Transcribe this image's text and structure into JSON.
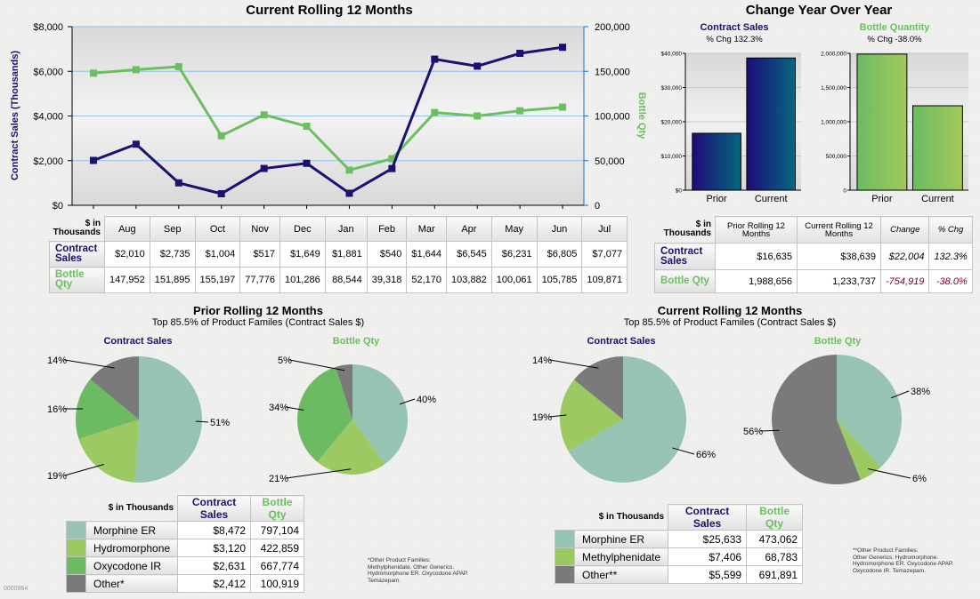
{
  "colors": {
    "navy": "#1c1070",
    "green": "#6bbf5f",
    "morphine_er": "#97c3b3",
    "hydromorphone": "#9dc962",
    "oxycodone_ir": "#6cbb63",
    "other": "#7a7a7a",
    "methylphenidate": "#9dc962",
    "negative": "#8b0020"
  },
  "chart_data": [
    {
      "id": "rolling12",
      "type": "line",
      "title": "Current Rolling 12 Months",
      "ylabel": "Contract Sales (Thousands)",
      "y2label": "Bottle Qty",
      "categories": [
        "Aug",
        "Sep",
        "Oct",
        "Nov",
        "Dec",
        "Jan",
        "Feb",
        "Mar",
        "Apr",
        "May",
        "Jun",
        "Jul"
      ],
      "ylim": [
        0,
        8000
      ],
      "y_ticks": [
        "$0",
        "$2,000",
        "$4,000",
        "$6,000",
        "$8,000"
      ],
      "y2lim": [
        0,
        200000
      ],
      "y2_ticks": [
        "0",
        "50,000",
        "100,000",
        "150,000",
        "200,000"
      ],
      "grid": true,
      "series": [
        {
          "name": "Contract Sales",
          "axis": "left",
          "values": [
            2010,
            2735,
            1004,
            517,
            1649,
            1881,
            540,
            1644,
            6545,
            6231,
            6805,
            7077
          ]
        },
        {
          "name": "Bottle Qty",
          "axis": "right",
          "values": [
            147952,
            151895,
            155197,
            77776,
            101286,
            88544,
            39318,
            52170,
            103882,
            100061,
            105785,
            109871
          ]
        }
      ]
    },
    {
      "id": "yoy_sales",
      "type": "bar",
      "title": "Contract Sales",
      "subtitle": "% Chg 132.3%",
      "categories": [
        "Prior",
        "Current"
      ],
      "values": [
        16635,
        38639
      ],
      "ylim": [
        0,
        40000
      ],
      "y_ticks": [
        "$0",
        "$10,000",
        "$20,000",
        "$30,000",
        "$40,000"
      ]
    },
    {
      "id": "yoy_qty",
      "type": "bar",
      "title": "Bottle Quantity",
      "subtitle": "% Chg -38.0%",
      "categories": [
        "Prior",
        "Current"
      ],
      "values": [
        1988656,
        1233737
      ],
      "ylim": [
        0,
        2000000
      ],
      "y_ticks": [
        "0",
        "500,000",
        "1,000,000",
        "1,500,000",
        "2,000,000"
      ]
    },
    {
      "id": "prior_sales_pie",
      "type": "pie",
      "title": "Contract Sales",
      "labels": [
        "Morphine ER",
        "Hydromorphone",
        "Oxycodone IR",
        "Other*"
      ],
      "values": [
        51,
        19,
        16,
        14
      ],
      "value_labels": [
        "51%",
        "19%",
        "16%",
        "14%"
      ]
    },
    {
      "id": "prior_qty_pie",
      "type": "pie",
      "title": "Bottle Qty",
      "labels": [
        "Morphine ER",
        "Hydromorphone",
        "Oxycodone IR",
        "Other*"
      ],
      "values": [
        40,
        21,
        34,
        5
      ],
      "value_labels": [
        "40%",
        "21%",
        "34%",
        "5%"
      ]
    },
    {
      "id": "current_sales_pie",
      "type": "pie",
      "title": "Contract Sales",
      "labels": [
        "Morphine ER",
        "Methylphenidate",
        "Other**"
      ],
      "values": [
        66,
        19,
        14
      ],
      "value_labels": [
        "66%",
        "19%",
        "14%"
      ]
    },
    {
      "id": "current_qty_pie",
      "type": "pie",
      "title": "Bottle Qty",
      "labels": [
        "Morphine ER",
        "Methylphenidate",
        "Other**"
      ],
      "values": [
        38,
        6,
        56
      ],
      "value_labels": [
        "38%",
        "6%",
        "56%"
      ]
    }
  ],
  "rolling": {
    "title": "Current Rolling 12 Months",
    "ylabel": "Contract Sales (Thousands)",
    "y2label": "Bottle Qty",
    "table": {
      "corner": [
        "$ in",
        "Thousands"
      ],
      "months": [
        "Aug",
        "Sep",
        "Oct",
        "Nov",
        "Dec",
        "Jan",
        "Feb",
        "Mar",
        "Apr",
        "May",
        "Jun",
        "Jul"
      ],
      "rows": [
        {
          "label": "Contract Sales",
          "values": [
            "$2,010",
            "$2,735",
            "$1,004",
            "$517",
            "$1,649",
            "$1,881",
            "$540",
            "$1,644",
            "$6,545",
            "$6,231",
            "$6,805",
            "$7,077"
          ]
        },
        {
          "label": "Bottle Qty",
          "values": [
            "147,952",
            "151,895",
            "155,197",
            "77,776",
            "101,286",
            "88,544",
            "39,318",
            "52,170",
            "103,882",
            "100,061",
            "105,785",
            "109,871"
          ]
        }
      ]
    }
  },
  "yoy": {
    "title": "Change Year Over Year",
    "sales_title": "Contract Sales",
    "sales_sub": "% Chg 132.3%",
    "qty_title": "Bottle Quantity",
    "qty_sub": "% Chg -38.0%",
    "table": {
      "corner": [
        "$ in",
        "Thousands"
      ],
      "headers": [
        "Prior Rolling 12 Months",
        "Current Rolling 12 Months",
        "Change",
        "% Chg"
      ],
      "rows": [
        {
          "label": "Contract Sales",
          "prior": "$16,635",
          "current": "$38,639",
          "change": "$22,004",
          "pct": "132.3%"
        },
        {
          "label": "Bottle Qty",
          "prior": "1,988,656",
          "current": "1,233,737",
          "change": "-754,919",
          "pct": "-38.0%"
        }
      ]
    }
  },
  "prior": {
    "title": "Prior Rolling 12 Months",
    "subtitle": "Top 85.5% of Product Familes (Contract Sales $)",
    "sales_label": "Contract Sales",
    "qty_label": "Bottle Qty",
    "legend": {
      "corner": "$ in Thousands",
      "col1": "Contract Sales",
      "col2": "Bottle Qty",
      "rows": [
        {
          "name": "Morphine ER",
          "sales": "$8,472",
          "qty": "797,104"
        },
        {
          "name": "Hydromorphone",
          "sales": "$3,120",
          "qty": "422,859"
        },
        {
          "name": "Oxycodone IR",
          "sales": "$2,631",
          "qty": "667,774"
        },
        {
          "name": "Other*",
          "sales": "$2,412",
          "qty": "100,919"
        }
      ]
    },
    "footnote": [
      "*Other Product Families:",
      "Methylphenidate. Other Generics.",
      "Hydromorphone ER. Oxycodone APAP.",
      "Temazepam."
    ]
  },
  "current": {
    "title": "Current Rolling 12 Months",
    "subtitle": "Top 85.5% of Product Familes (Contract Sales $)",
    "sales_label": "Contract Sales",
    "qty_label": "Bottle Qty",
    "legend": {
      "corner": "$ in Thousands",
      "col1": "Contract Sales",
      "col2": "Bottle Qty",
      "rows": [
        {
          "name": "Morphine ER",
          "sales": "$25,633",
          "qty": "473,062"
        },
        {
          "name": "Methylphenidate",
          "sales": "$7,406",
          "qty": "68,783"
        },
        {
          "name": "Other**",
          "sales": "$5,599",
          "qty": "691,891"
        }
      ]
    },
    "footnote": [
      "**Other Product Families:",
      "Other Generics. Hydromorphone.",
      "Hydromorphone ER. Oxycodone APAP.",
      "Oxycodone IR. Temazepam."
    ]
  },
  "page_id": "0000864"
}
